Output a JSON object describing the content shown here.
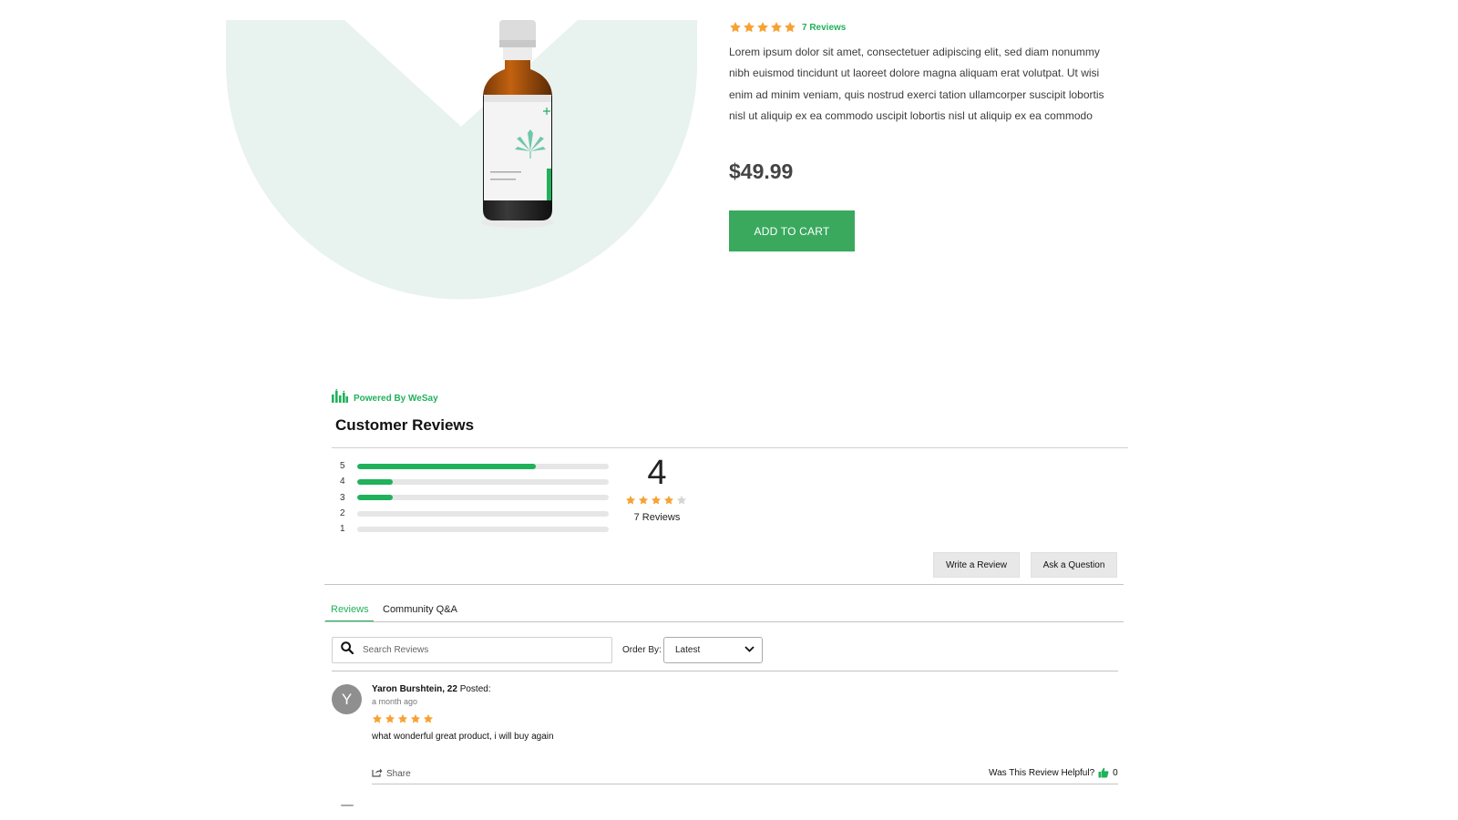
{
  "product": {
    "rating": 5,
    "reviews_link": "7 Reviews",
    "description": "Lorem ipsum dolor sit amet, consectetuer adipiscing elit, sed diam nonummy nibh euismod tincidunt ut laoreet dolore magna aliquam erat volutpat. Ut wisi enim ad minim veniam, quis nostrud exerci tation ullamcorper suscipit lobortis nisl ut aliquip ex ea commodo uscipit lobortis nisl ut aliquip ex ea commodo",
    "price": "$49.99",
    "add_to_cart_label": "ADD TO CART"
  },
  "reviews_widget": {
    "powered_by": "Powered By WeSay",
    "title": "Customer Reviews",
    "histogram": [
      {
        "label": "5",
        "fraction": 0.71
      },
      {
        "label": "4",
        "fraction": 0.14
      },
      {
        "label": "3",
        "fraction": 0.14
      },
      {
        "label": "2",
        "fraction": 0
      },
      {
        "label": "1",
        "fraction": 0
      }
    ],
    "average": "4",
    "average_stars": 4,
    "count_label": "7 Reviews",
    "write_review_label": "Write a Review",
    "ask_question_label": "Ask a Question",
    "tabs": [
      {
        "label": "Reviews",
        "active": true
      },
      {
        "label": "Community Q&A",
        "active": false
      }
    ],
    "search_placeholder": "Search Reviews",
    "order_by_label": "Order By:",
    "order_by_value": "Latest",
    "reviews": [
      {
        "avatar_letter": "Y",
        "name": "Yaron Burshtein, 22",
        "posted_label": "Posted:",
        "when": "a month ago",
        "stars": 5,
        "body": "what wonderful great product, i will buy again",
        "share_label": "Share",
        "helpful_label": "Was This Review Helpful?",
        "helpful_count": "0"
      }
    ]
  },
  "colors": {
    "brand_green": "#21b15a",
    "cart_button": "#3aa95e",
    "star_orange": "#f7a234",
    "star_empty": "#d6d6d6",
    "hero_bg": "#e8f2ee"
  }
}
